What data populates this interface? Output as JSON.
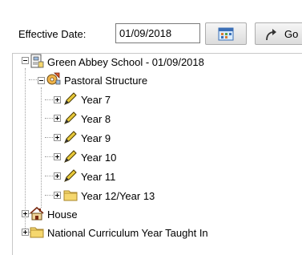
{
  "toolbar": {
    "effective_date_label": "Effective Date:",
    "effective_date_value": "01/09/2018",
    "go_label": "Go"
  },
  "tree": {
    "root": "Green Abbey School - 01/09/2018",
    "pastoral": "Pastoral Structure",
    "years": [
      "Year  7",
      "Year  8",
      "Year  9",
      "Year 10",
      "Year 11"
    ],
    "year_12_13": "Year 12/Year 13",
    "house": "House",
    "national": "National Curriculum Year Taught In"
  },
  "colors": {
    "folder": "#f5d76e",
    "pencil": "#e8c93a"
  }
}
